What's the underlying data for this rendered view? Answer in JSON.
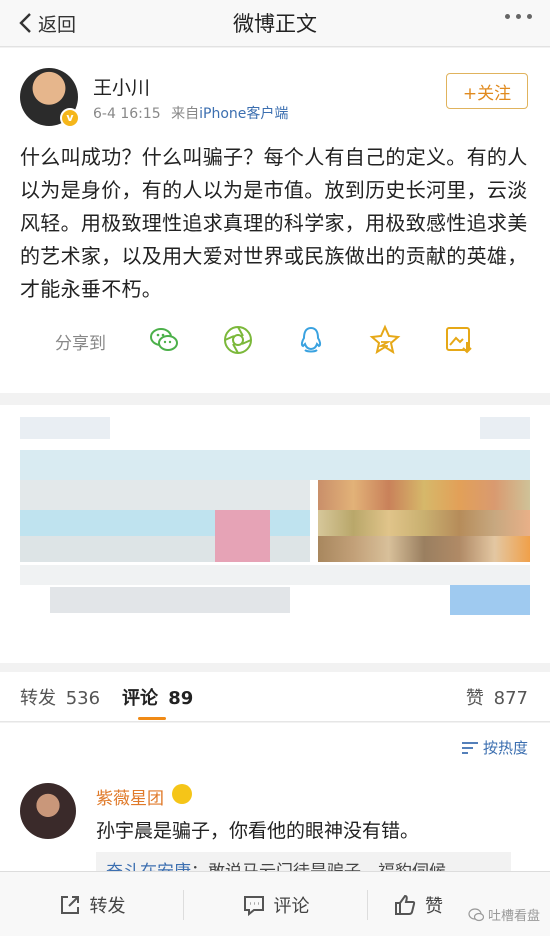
{
  "nav": {
    "back_label": "返回",
    "title": "微博正文"
  },
  "post": {
    "author": "王小川",
    "time": "6-4 16:15",
    "source_prefix": "来自",
    "source": "iPhone客户端",
    "follow_label": "+关注",
    "verified_badge": "v",
    "content": "什么叫成功？什么叫骗子？每个人有自己的定义。有的人以为是身价，有的人以为是市值。放到历史长河里，云淡风轻。用极致理性追求真理的科学家，用极致感性追求美的艺术家，以及用大爱对世界或民族做出的贡献的英雄，才能永垂不朽。",
    "share_label": "分享到",
    "share_icons": [
      "wechat-icon",
      "moments-icon",
      "qq-icon",
      "favorite-icon",
      "save-image-icon"
    ]
  },
  "tabs": {
    "repost_label": "转发",
    "repost_count": "536",
    "comment_label": "评论",
    "comment_count": "89",
    "like_label": "赞",
    "like_count": "877"
  },
  "comments": {
    "sort_label": "按热度",
    "items": [
      {
        "name": "紫薇星团",
        "text": "孙宇晨是骗子，你看他的眼神没有错。",
        "reply_name": "奋斗在安康",
        "reply_text": "：敢说马云门徒是骗子，福豹伺候"
      }
    ]
  },
  "bottom": {
    "repost_label": "转发",
    "comment_label": "评论",
    "like_label": "赞",
    "watermark": "吐槽看盘"
  },
  "colors": {
    "accent": "#f08a16",
    "link": "#3c6fb0",
    "follow": "#e08a1e"
  }
}
